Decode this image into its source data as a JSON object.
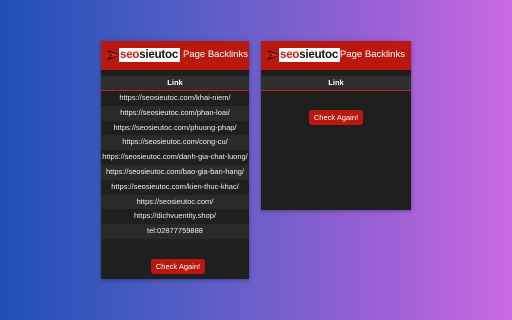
{
  "brand": {
    "logo_prefix": "seo",
    "logo_suffix": "sieutoc",
    "title": "Page Backlinks"
  },
  "left_panel": {
    "column_header": "Link",
    "links": [
      "https://seosieutoc.com/khai-niem/",
      "https://seosieutoc.com/phan-loai/",
      "https://seosieutoc.com/phuong-phap/",
      "https://seosieutoc.com/cong-cu/",
      "https://seosieutoc.com/danh-gia-chat-luong/",
      "https://seosieutoc.com/bao-gia-ban-hang/",
      "https://seosieutoc.com/kien-thuc-khac/",
      "https://seosieutoc.com/",
      "https://dichvuentity.shop/",
      "tel:02877759888"
    ],
    "button_label": "Check Again!"
  },
  "right_panel": {
    "column_header": "Link",
    "button_label": "Check Again!"
  }
}
